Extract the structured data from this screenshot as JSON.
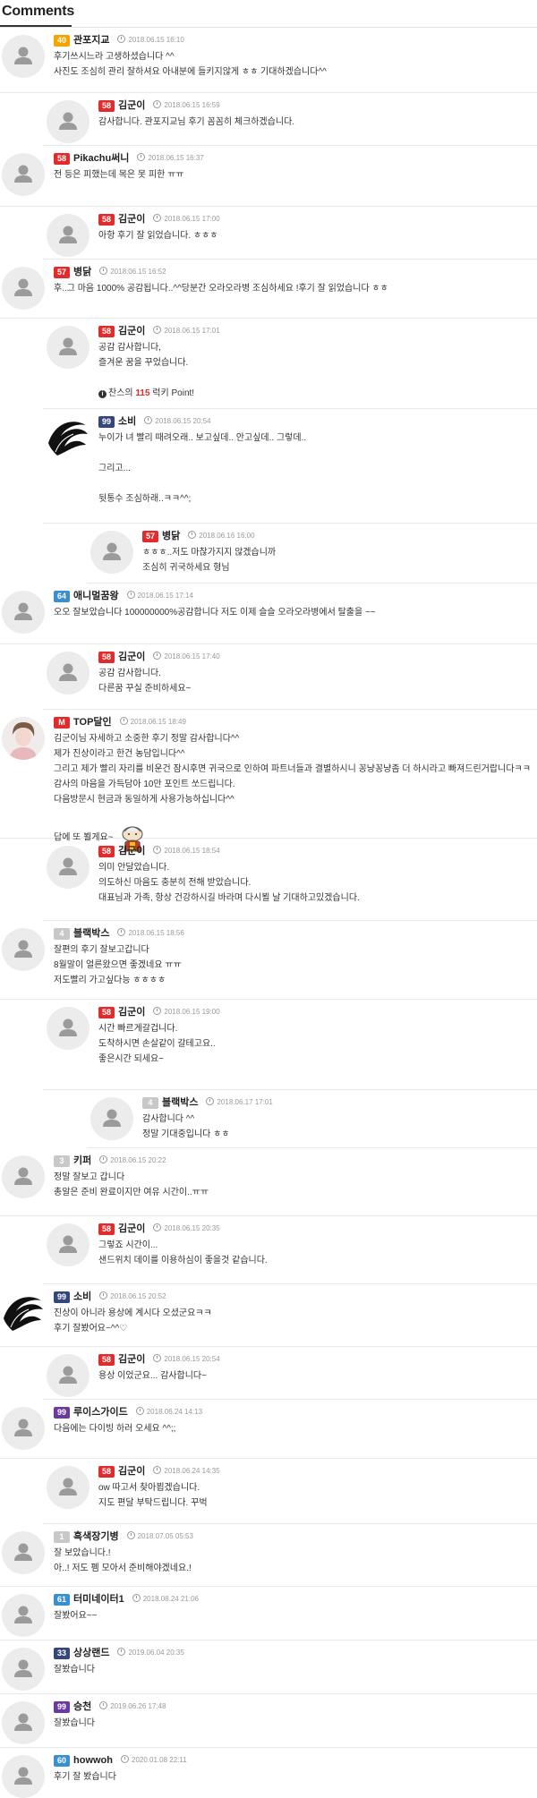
{
  "header": {
    "title": "Comments"
  },
  "comments": [
    {
      "level": "40",
      "levelColor": "#f5a500",
      "nick": "관포지교",
      "time": "2018.06.15 16:10",
      "lines": [
        "후기쓰시느라 고생하셨습니다 ^^",
        "사진도 조심히 관리 잘하셔요 아내분에 들키지않게 ㅎㅎ 기대하겠습니다^^"
      ]
    },
    {
      "level": "58",
      "levelColor": "#e22b2b",
      "nick": "김군이",
      "time": "2018.06.15 16:59",
      "lines": [
        "감사합니다. 관포지교님 후기 꼼꼼히 체크하겠습니다."
      ]
    },
    {
      "level": "58",
      "levelColor": "#e22b2b",
      "nick": "Pikachu써니",
      "time": "2018.06.15 16:37",
      "lines": [
        "전 등은 피했는데 목은 못 피한 ㅠㅠ"
      ]
    },
    {
      "level": "58",
      "levelColor": "#e22b2b",
      "nick": "김군이",
      "time": "2018.06.15 17:00",
      "lines": [
        "아항 후기 잘 읽었습니다. ㅎㅎㅎ"
      ]
    },
    {
      "level": "57",
      "levelColor": "#e22b2b",
      "nick": "병닭",
      "time": "2018.06.15 16:52",
      "lines": [
        "후..그 마음 1000% 공감됩니다..^^당분간 오라오라병 조심하세요 !후기 잘 읽었습니다 ㅎㅎ"
      ]
    },
    {
      "level": "58",
      "levelColor": "#e22b2b",
      "nick": "김군이",
      "time": "2018.06.15 17:01",
      "lines": [
        "공감 감사합니다,",
        "즐겨운 꿈을 꾸었습니다."
      ],
      "point_prefix": "찬스의 ",
      "point_value": "115",
      "point_suffix": " 럭키 Point!"
    },
    {
      "level": "99",
      "levelColor": "#34477a",
      "nick": "소비",
      "time": "2018.06.15 20:54",
      "lines": [
        "누이가 녀 빨리 때려오래.. 보고싶데.. 안고싶데.. 그렇데..",
        "",
        "그리고...",
        "",
        "뒷통수 조심하래..ㅋㅋ^^;"
      ]
    },
    {
      "level": "57",
      "levelColor": "#e22b2b",
      "nick": "병닭",
      "time": "2018.06.16 16:00",
      "lines": [
        "ㅎㅎㅎ..저도 마찮가지지 않겠습니까",
        "조심히 귀국하세요 형님"
      ]
    },
    {
      "level": "64",
      "levelColor": "#3a8fcf",
      "nick": "애니멀꿈왕",
      "time": "2018.06.15 17:14",
      "lines": [
        "오오 잘보았습니다 100000000%공감합니다 저도 이제 슬슬 오라오라병에서 탈출을 ~~"
      ]
    },
    {
      "level": "58",
      "levelColor": "#e22b2b",
      "nick": "김군이",
      "time": "2018.06.15 17:40",
      "lines": [
        "공감 감사합니다.",
        "다른꿈 꾸실 준비하세요~"
      ]
    },
    {
      "level": "M",
      "levelColor": "#e22b2b",
      "nick": "TOP달인",
      "time": "2018.06.15 18:49",
      "lines": [
        "김군이님 자세하고 소중한 후기 정말 감사합니다^^",
        "제가 진상이라고 한건 농담입니다^^",
        "그리고 제가 빨리 자리를 비운건 잠시후면 귀국으로 인하여 파트너들과 결별하시니 꽁냥꽁냥좀 더 하시라고 빠져드린거랍니다ㅋㅋ",
        "감사의 마음을 가득담아 10만 포인트 쏘드립니다.",
        "다음방문시 현금과 동일하게 사용가능하십니다^^",
        "",
        "답에 또 뵐게요~"
      ]
    },
    {
      "level": "58",
      "levelColor": "#e22b2b",
      "nick": "김군이",
      "time": "2018.06.15 18:54",
      "lines": [
        "의미 안달았습니다.",
        "의도하신 마음도 충분히 전해 받았습니다.",
        "대표님과 가족, 항상 건강하시길 바라며 다시뵐 날 기대하고있겠습니다."
      ]
    },
    {
      "level": "4",
      "levelColor": "#c8c8c8",
      "nick": "블랙박스",
      "time": "2018.06.15 18:56",
      "lines": [
        "잘편의 후기 잘보고갑니다",
        "8월말이 얼른왔으면 좋겠네요 ㅠㅠ",
        "저도빨리 가고싶다능 ㅎㅎㅎㅎ"
      ]
    },
    {
      "level": "58",
      "levelColor": "#e22b2b",
      "nick": "김군이",
      "time": "2018.06.15 19:00",
      "lines": [
        "시간 빠르게갈겁니다.",
        "도착하시면 손살같이 갈테고요..",
        "좋은시간 되세요~"
      ]
    },
    {
      "level": "4",
      "levelColor": "#c8c8c8",
      "nick": "블랙박스",
      "time": "2018.06.17 17:01",
      "lines": [
        "감사합니다 ^^",
        "정말 기대중입니다 ㅎㅎ"
      ]
    },
    {
      "level": "3",
      "levelColor": "#c8c8c8",
      "nick": "키퍼",
      "time": "2018.06.15 20:22",
      "lines": [
        "정말 잘보고 갑니다",
        "총알은 준비 완료이지만 여유 시간이..ㅠㅠ"
      ]
    },
    {
      "level": "58",
      "levelColor": "#e22b2b",
      "nick": "김군이",
      "time": "2018.06.15 20:35",
      "lines": [
        "그렇죠 시간이...",
        "샌드위치 데이를 이용하심이 좋을것 같습니다."
      ]
    },
    {
      "level": "99",
      "levelColor": "#34477a",
      "nick": "소비",
      "time": "2018.06.15 20:52",
      "lines": [
        "진상이 아니라 용상에 계시다 오셨군요ㅋㅋ",
        "후기 잘봤어요~^^♡"
      ]
    },
    {
      "level": "58",
      "levelColor": "#e22b2b",
      "nick": "김군이",
      "time": "2018.06.15 20:54",
      "lines": [
        "용상 이었군요... 감사합니다~"
      ]
    },
    {
      "level": "99",
      "levelColor": "#6a3a9f",
      "nick": "루이스가이드",
      "time": "2018.06.24 14:13",
      "lines": [
        "다음에는 다이빙 하러 오세요 ^^;;"
      ]
    },
    {
      "level": "58",
      "levelColor": "#e22b2b",
      "nick": "김군이",
      "time": "2018.06.24 14:35",
      "lines": [
        "ow 따고서 찾아뵙겠습니다.",
        "지도 편달 부탁드립니다. 꾸벅"
      ]
    },
    {
      "level": "1",
      "levelColor": "#c8c8c8",
      "nick": "흑색장기병",
      "time": "2018.07.05 05:53",
      "lines": [
        "잘 보았습니다.!",
        "아..!  저도 펨 모아서 준비해야겠네요.!"
      ]
    },
    {
      "level": "61",
      "levelColor": "#3a8fcf",
      "nick": "터미네이터1",
      "time": "2018.08.24 21:06",
      "lines": [
        "잘봤어요~~"
      ]
    },
    {
      "level": "33",
      "levelColor": "#34477a",
      "nick": "상상랜드",
      "time": "2019.06.04 20:35",
      "lines": [
        "잘봤습니다"
      ]
    },
    {
      "level": "99",
      "levelColor": "#6a3a9f",
      "nick": "승천",
      "time": "2019.06.26 17:48",
      "lines": [
        "잘봤습니다"
      ]
    },
    {
      "level": "60",
      "levelColor": "#3a8fcf",
      "nick": "howwoh",
      "time": "2020.01.08 22:11",
      "lines": [
        "후기 잘 봤습니다"
      ]
    }
  ]
}
